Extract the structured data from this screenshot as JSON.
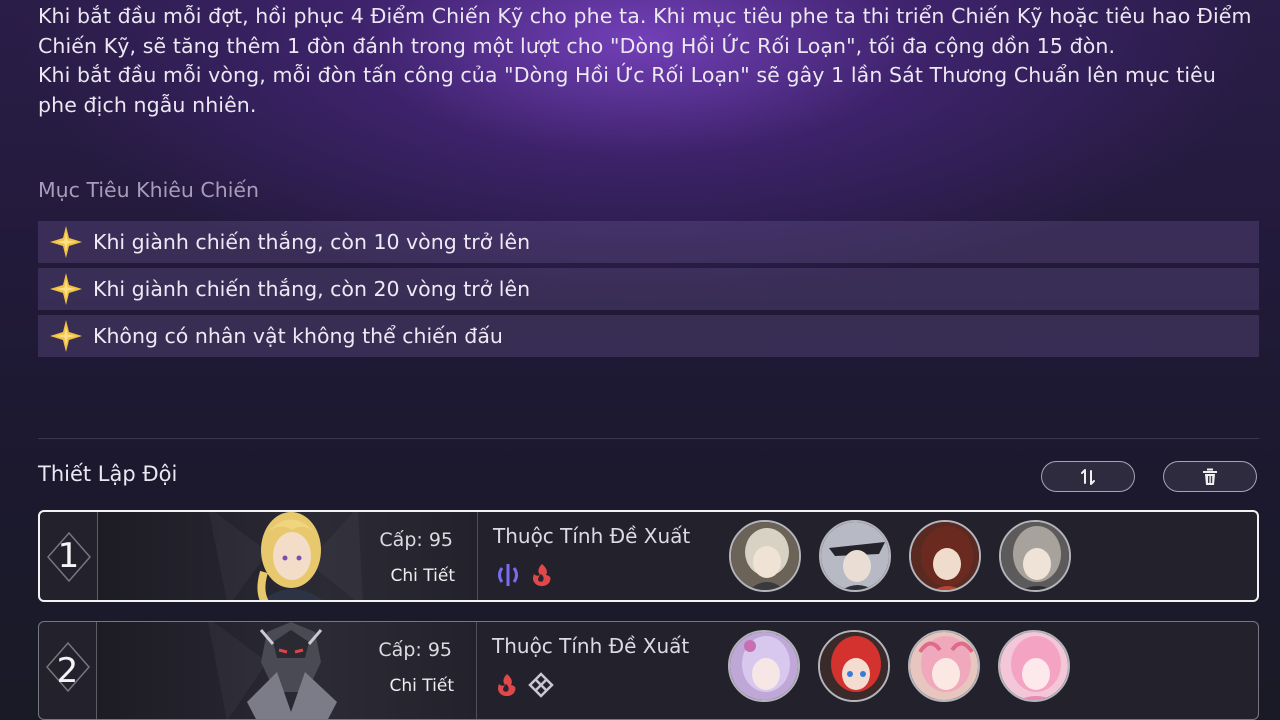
{
  "description": {
    "line1": "Khi bắt đầu mỗi đợt, hồi phục 4 Điểm Chiến Kỹ cho phe ta. Khi mục tiêu phe ta thi triển Chiến Kỹ hoặc tiêu hao Điểm Chiến Kỹ, sẽ tăng thêm 1 đòn đánh trong một lượt cho \"Dòng Hồi Ức Rối Loạn\", tối đa cộng dồn 15 đòn.",
    "line2": "Khi bắt đầu mỗi vòng, mỗi đòn tấn công của \"Dòng Hồi Ức Rối Loạn\" sẽ gây 1 lần Sát Thương Chuẩn lên mục tiêu phe địch ngẫu nhiên."
  },
  "objectives": {
    "title": "Mục Tiêu Khiêu Chiến",
    "items": [
      {
        "label": "Khi giành chiến thắng, còn 10 vòng trở lên",
        "icon": "star-icon"
      },
      {
        "label": "Khi giành chiến thắng, còn 20 vòng trở lên",
        "icon": "star-icon"
      },
      {
        "label": "Không có nhân vật không thể chiến đấu",
        "icon": "star-icon"
      }
    ]
  },
  "team": {
    "title": "Thiết Lập Đội",
    "buttons": [
      {
        "icon": "swap-icon"
      },
      {
        "icon": "trash-icon"
      }
    ],
    "rows": [
      {
        "number": "1",
        "level": "Cấp: 95",
        "detail": "Chi Tiết",
        "recommend": "Thuộc Tính Đề Xuất",
        "elements": [
          "imaginary-icon",
          "fire-icon"
        ],
        "selected": true,
        "portrait_color": "#e6c56a"
      },
      {
        "number": "2",
        "level": "Cấp: 95",
        "detail": "Chi Tiết",
        "recommend": "Thuộc Tính Đề Xuất",
        "elements": [
          "fire-icon",
          "ice-icon"
        ],
        "selected": false,
        "portrait_color": "#6f6f7a"
      }
    ]
  },
  "colors": {
    "accent_gold": "#f0c040",
    "fire": "#e0484a",
    "imaginary": "#7a6cf0"
  }
}
